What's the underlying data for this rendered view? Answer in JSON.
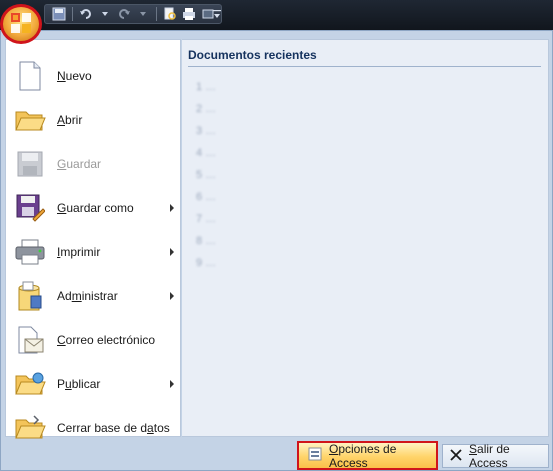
{
  "toolbar": {
    "icons": [
      "save-icon",
      "undo-icon",
      "redo-icon",
      "print-preview-icon",
      "print-icon",
      "more-icon"
    ],
    "customize_arrow": "▾"
  },
  "menu": {
    "items": [
      {
        "label": "Nuevo",
        "mnemonic_index": 0,
        "icon": "new-document-icon",
        "enabled": true,
        "submenu": false
      },
      {
        "label": "Abrir",
        "mnemonic_index": 0,
        "icon": "open-folder-icon",
        "enabled": true,
        "submenu": false
      },
      {
        "label": "Guardar",
        "mnemonic_index": 0,
        "icon": "save-disk-icon",
        "enabled": false,
        "submenu": false
      },
      {
        "label": "Guardar como",
        "mnemonic_index": 0,
        "icon": "save-as-icon",
        "enabled": true,
        "submenu": true
      },
      {
        "label": "Imprimir",
        "mnemonic_index": 0,
        "icon": "printer-icon",
        "enabled": true,
        "submenu": true
      },
      {
        "label": "Administrar",
        "mnemonic_index": 2,
        "icon": "manage-database-icon",
        "enabled": true,
        "submenu": true
      },
      {
        "label": "Correo electrónico",
        "mnemonic_index": 0,
        "icon": "email-icon",
        "enabled": true,
        "submenu": false
      },
      {
        "label": "Publicar",
        "mnemonic_index": 1,
        "icon": "publish-icon",
        "enabled": true,
        "submenu": true
      },
      {
        "label": "Cerrar base de datos",
        "mnemonic_index": 16,
        "icon": "close-database-icon",
        "enabled": true,
        "submenu": false
      }
    ]
  },
  "recent": {
    "title": "Documentos recientes",
    "items": [
      "1 ...",
      "2 ...",
      "3 ...",
      "4 ...",
      "5 ...",
      "6 ...",
      "7 ...",
      "8 ...",
      "9 ..."
    ]
  },
  "footer": {
    "options_label": "Opciones de Access",
    "exit_label": "Salir de Access"
  },
  "colors": {
    "accent_red": "#d0141b",
    "menu_blue": "#c4d3e6",
    "title_blue": "#15325e"
  }
}
